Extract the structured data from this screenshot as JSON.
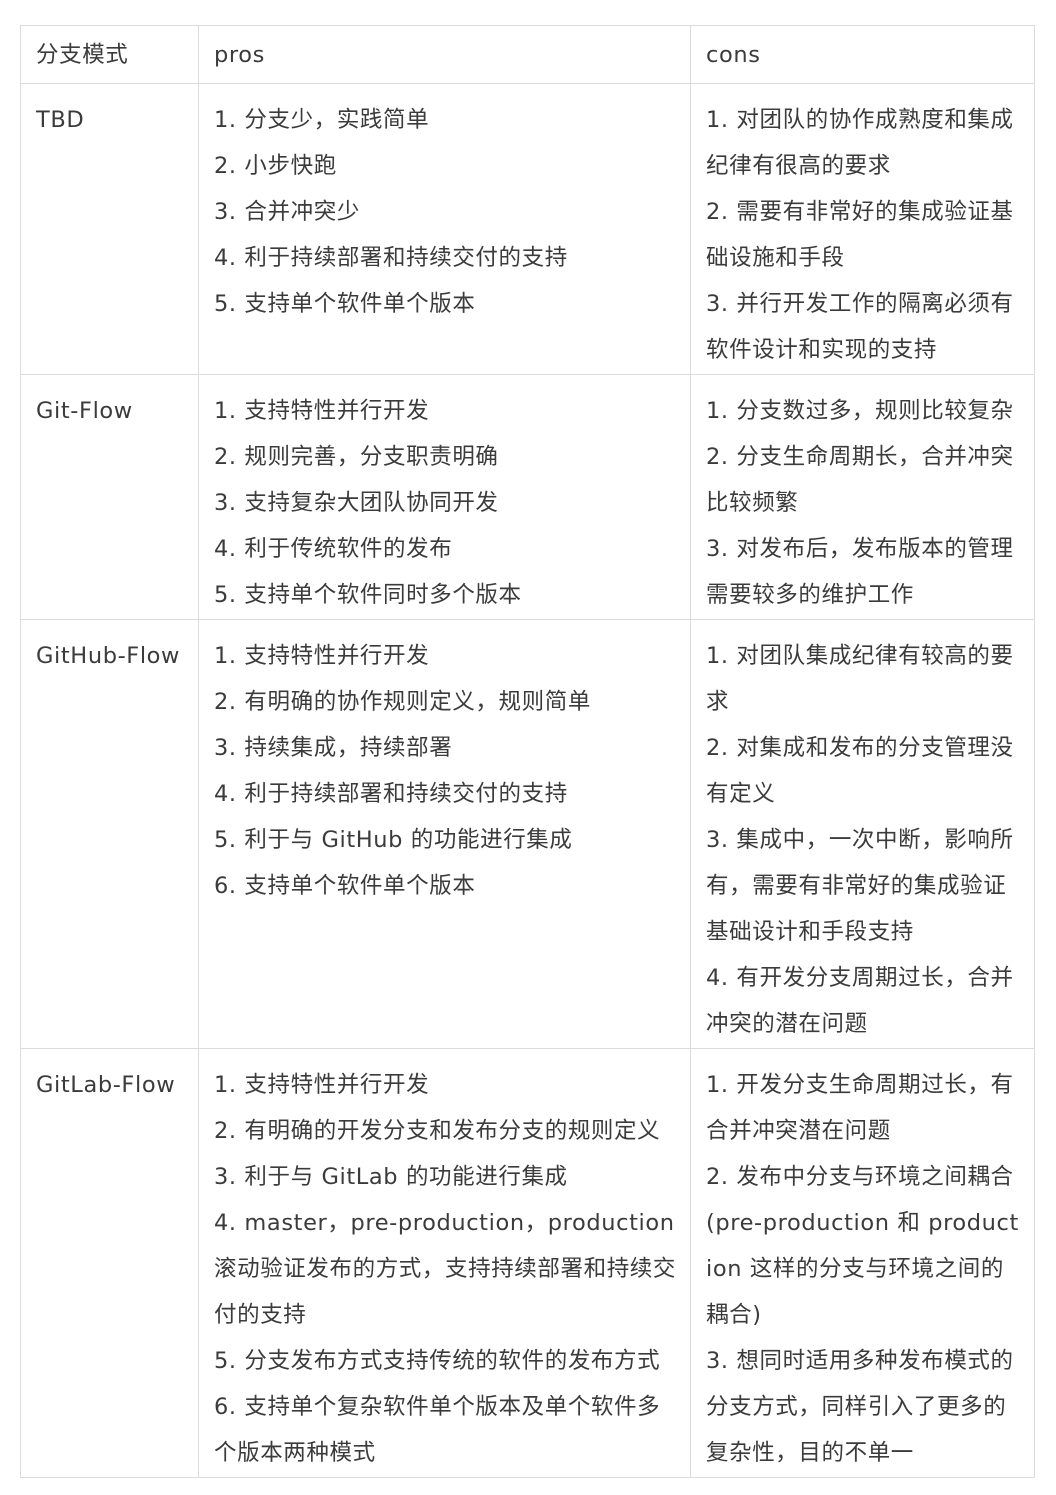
{
  "table": {
    "headers": {
      "mode": "分支模式",
      "pros": "pros",
      "cons": "cons"
    },
    "rows": [
      {
        "mode": "TBD",
        "pros": [
          "1. 分支少，实践简单",
          "2. 小步快跑",
          "3. 合并冲突少",
          "4. 利于持续部署和持续交付的支持",
          "5. 支持单个软件单个版本"
        ],
        "cons": [
          "1. 对团队的协作成熟度和集成纪律有很高的要求",
          "2. 需要有非常好的集成验证基础设施和手段",
          "3. 并行开发工作的隔离必须有软件设计和实现的支持"
        ]
      },
      {
        "mode": "Git-Flow",
        "pros": [
          "1. 支持特性并行开发",
          "2. 规则完善，分支职责明确",
          "3. 支持复杂大团队协同开发",
          "4. 利于传统软件的发布",
          "5. 支持单个软件同时多个版本"
        ],
        "cons": [
          "1. 分支数过多，规则比较复杂",
          "2. 分支生命周期长，合并冲突比较频繁",
          "3. 对发布后，发布版本的管理需要较多的维护工作"
        ]
      },
      {
        "mode": "GitHub-Flow",
        "pros": [
          "1. 支持特性并行开发",
          "2. 有明确的协作规则定义，规则简单",
          "3. 持续集成，持续部署",
          "4. 利于持续部署和持续交付的支持",
          "5. 利于与 GitHub 的功能进行集成",
          "6. 支持单个软件单个版本"
        ],
        "cons": [
          "1. 对团队集成纪律有较高的要求",
          "2. 对集成和发布的分支管理没有定义",
          "3. 集成中，一次中断，影响所有，需要有非常好的集成验证基础设计和手段支持",
          "4. 有开发分支周期过长，合并冲突的潜在问题"
        ]
      },
      {
        "mode": "GitLab-Flow",
        "pros": [
          "1. 支持特性并行开发",
          "2. 有明确的开发分支和发布分支的规则定义",
          "3. 利于与 GitLab 的功能进行集成",
          "4. master，pre-production，production 滚动验证发布的方式，支持持续部署和持续交付的支持",
          "5. 分支发布方式支持传统的软件的发布方式",
          "6. 支持单个复杂软件单个版本及单个软件多个版本两种模式"
        ],
        "cons": [
          "1. 开发分支生命周期过长，有合并冲突潜在问题",
          "2. 发布中分支与环境之间耦合(pre-production 和 production 这样的分支与环境之间的耦合)",
          "3. 想同时适用多种发布模式的分支方式，同样引入了更多的复杂性，目的不单一"
        ]
      }
    ]
  }
}
